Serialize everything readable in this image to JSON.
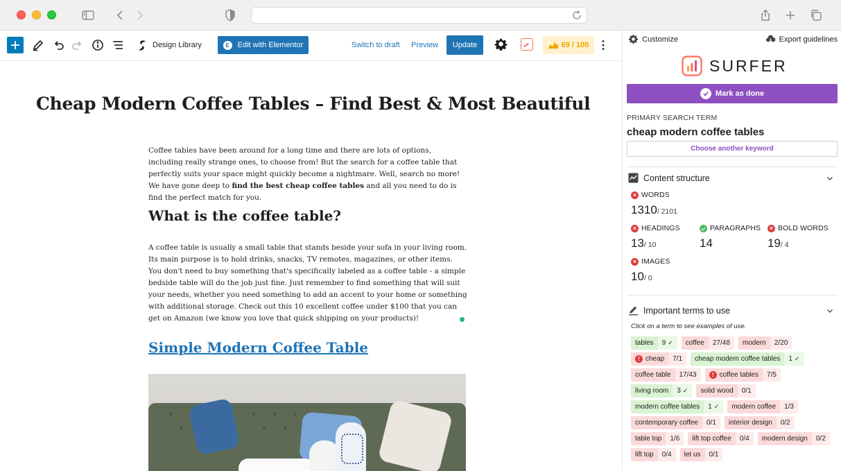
{
  "browser": {
    "url": ""
  },
  "toolbar": {
    "design_library": "Design Library",
    "edit_elementor": "Edit with Elementor",
    "switch_to_draft": "Switch to draft",
    "preview": "Preview",
    "update": "Update",
    "score": "69 / 100"
  },
  "article": {
    "title": "Cheap Modern Coffee Tables – Find Best & Most Beautiful",
    "intro_plain": "Coffee tables have been around for a long time and there are lots of options, including really strange ones, to choose from! But the search for a coffee table that perfectly suits your space might quickly become a nightmare. Well, search no more! We have gone deep to ",
    "intro_bold": "find the best cheap coffee tables",
    "intro_end": " and all you need to do is find the perfect match for you.",
    "heading1": "What is the coffee table?",
    "paragraph2": "A coffee table is usually a small table that stands beside your sofa in your living room. Its main purpose is to hold drinks, snacks, TV remotes, magazines, or other items. You don't need to buy something that's specifically labeled as a coffee table - a simple bedside table will do the job just fine. Just remember to find something that will suit your needs, whether you need something to add an accent to your home or something with additional storage. Check out this 10 excellent coffee under $100 that you can get on Amazon (we know you love that quick shipping on your products)!",
    "heading2_link": "Simple Modern Coffee Table"
  },
  "sidebar": {
    "customize": "Customize",
    "export": "Export guidelines",
    "logo_text": "SURFER",
    "mark_done": "Mark as done",
    "primary_label": "PRIMARY SEARCH TERM",
    "primary_term": "cheap modern coffee tables",
    "choose_keyword": "Choose another keyword",
    "content_structure": {
      "title": "Content structure",
      "words_label": "WORDS",
      "words_value": "1310",
      "words_target": "/ 2101",
      "headings_label": "HEADINGS",
      "headings_value": "13",
      "headings_target": "/ 10",
      "paragraphs_label": "PARAGRAPHS",
      "paragraphs_value": "14",
      "bold_label": "BOLD WORDS",
      "bold_value": "19",
      "bold_target": "/ 4",
      "images_label": "IMAGES",
      "images_value": "10",
      "images_target": "/ 0"
    },
    "important_terms": {
      "title": "Important terms to use",
      "hint": "Click on a term to see examples of use.",
      "terms": [
        {
          "name": "tables",
          "count": "9",
          "status": "good",
          "warn": false,
          "check": true
        },
        {
          "name": "coffee",
          "count": "27/48",
          "status": "bad",
          "warn": false,
          "check": false
        },
        {
          "name": "modern",
          "count": "2/20",
          "status": "bad",
          "warn": false,
          "check": false
        },
        {
          "name": "cheap",
          "count": "7/1",
          "status": "bad",
          "warn": true,
          "check": false
        },
        {
          "name": "cheap modern coffee tables",
          "count": "1",
          "status": "good",
          "warn": false,
          "check": true
        },
        {
          "name": "coffee table",
          "count": "17/43",
          "status": "bad",
          "warn": false,
          "check": false
        },
        {
          "name": "coffee tables",
          "count": "7/5",
          "status": "bad",
          "warn": true,
          "check": false
        },
        {
          "name": "living room",
          "count": "3",
          "status": "good",
          "warn": false,
          "check": true
        },
        {
          "name": "solid wood",
          "count": "0/1",
          "status": "bad",
          "warn": false,
          "check": false
        },
        {
          "name": "modern coffee tables",
          "count": "1",
          "status": "good",
          "warn": false,
          "check": true
        },
        {
          "name": "modern coffee",
          "count": "1/3",
          "status": "bad",
          "warn": false,
          "check": false
        },
        {
          "name": "contemporary coffee",
          "count": "0/1",
          "status": "bad",
          "warn": false,
          "check": false
        },
        {
          "name": "interior design",
          "count": "0/2",
          "status": "bad",
          "warn": false,
          "check": false
        },
        {
          "name": "table top",
          "count": "1/6",
          "status": "bad",
          "warn": false,
          "check": false
        },
        {
          "name": "lift top coffee",
          "count": "0/4",
          "status": "bad",
          "warn": false,
          "check": false
        },
        {
          "name": "modern design",
          "count": "0/2",
          "status": "bad",
          "warn": false,
          "check": false
        },
        {
          "name": "lift top",
          "count": "0/4",
          "status": "bad",
          "warn": false,
          "check": false
        },
        {
          "name": "let us",
          "count": "0/1",
          "status": "bad",
          "warn": false,
          "check": false
        }
      ]
    }
  }
}
